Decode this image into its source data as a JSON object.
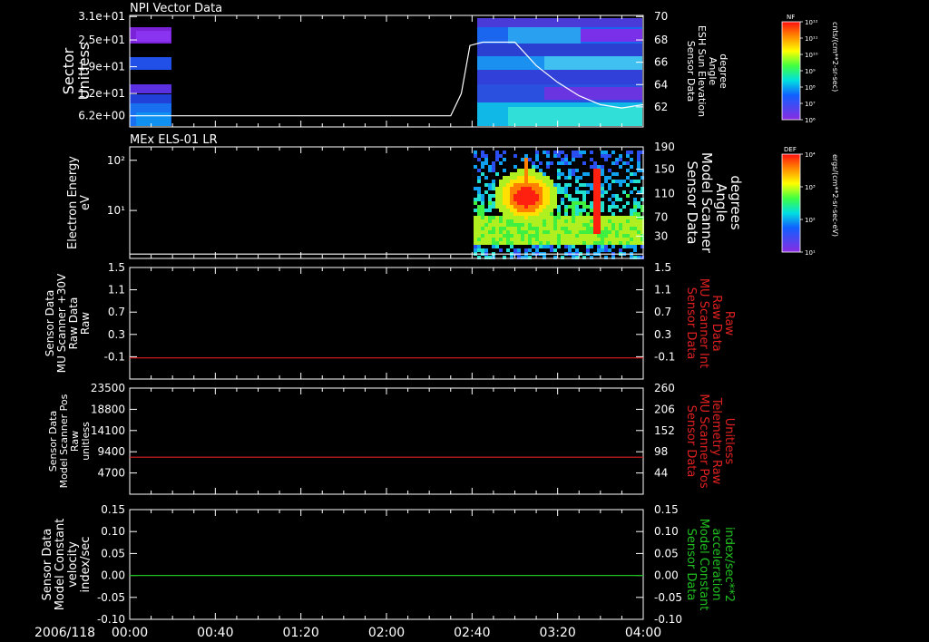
{
  "colors": {
    "background": "#000000",
    "axis": "#ffffff",
    "red_trace": "#e02020",
    "green_trace": "#20c020",
    "white_trace": "#ffffff"
  },
  "time_axis": {
    "date_label": "2006/118",
    "ticks": [
      "00:00",
      "00:40",
      "01:20",
      "02:00",
      "02:40",
      "03:20",
      "04:00"
    ]
  },
  "colorbars": [
    {
      "label": "NF",
      "unit": "cnts/(cm**2-sr-sec)",
      "tick_labels": [
        "10¹²",
        "10¹¹",
        "10¹⁰",
        "10⁹",
        "10⁸",
        "10⁷",
        "10⁶"
      ]
    },
    {
      "label": "DEF",
      "unit": "ergs/(cm**2-sr-sec-eV)",
      "tick_labels": [
        "10⁴",
        "10³",
        "10²",
        "10¹"
      ]
    }
  ],
  "chart_data": [
    {
      "type": "heatmap",
      "title": "NPI Vector Data",
      "ylabel": [
        "Sector",
        "Unitless"
      ],
      "yticks": [
        "3.1e+01",
        "2.5e+01",
        "1.9e+01",
        "1.2e+01",
        "6.2e+00"
      ],
      "y2label": [
        "Sensor Data",
        "ESH Sun Elevation",
        "Angle",
        "degree"
      ],
      "y2ticks": [
        "70",
        "68",
        "66",
        "64",
        "62"
      ],
      "y2lim": [
        60,
        70
      ],
      "overlay": {
        "name": "ESH Sun Elevation Angle",
        "x": [
          "00:00",
          "02:30",
          "02:35",
          "02:39",
          "02:45",
          "03:00",
          "03:10",
          "03:20",
          "03:30",
          "03:40",
          "03:50",
          "04:00"
        ],
        "y": [
          61.0,
          61.0,
          63.0,
          67.3,
          67.6,
          67.6,
          65.5,
          64.0,
          62.8,
          62.0,
          61.7,
          62.0
        ]
      }
    },
    {
      "type": "heatmap",
      "title": "MEx ELS-01 LR",
      "ylabel": [
        "Electron Energy",
        "eV"
      ],
      "yticks": [
        "10²",
        "10¹"
      ],
      "y2label": [
        "Sensor Data",
        "Model Scanner",
        "Angle",
        "degrees"
      ],
      "y2ticks": [
        "190",
        "150",
        "110",
        "70",
        "30"
      ],
      "y2lim": [
        10,
        190
      ],
      "overlay": {
        "name": "Model Scanner Angle",
        "x": [
          "00:00",
          "04:00"
        ],
        "y": [
          17,
          17
        ]
      }
    },
    {
      "type": "line",
      "ylabel": [
        "Sensor Data",
        "MU Scanner +30V",
        "Raw Data",
        "Raw"
      ],
      "yticks": [
        "1.5",
        "1.1",
        "0.7",
        "0.3",
        "-0.1"
      ],
      "ylim": [
        -0.35,
        1.5
      ],
      "y2label": [
        "Sensor Data",
        "MU Scanner Int",
        "Raw Data",
        "Raw"
      ],
      "y2ticks": [
        "1.5",
        "1.1",
        "0.7",
        "0.3",
        "-0.1"
      ],
      "series": [
        {
          "x": [
            "00:00",
            "04:00"
          ],
          "y": [
            0.0,
            0.0
          ],
          "color": "#e02020"
        }
      ]
    },
    {
      "type": "line",
      "ylabel": [
        "Sensor Data",
        "Model Scanner Pos",
        "Raw",
        "unitless"
      ],
      "yticks": [
        "23500",
        "18800",
        "14100",
        "9400",
        "4700"
      ],
      "ylim": [
        0,
        23500
      ],
      "y2label": [
        "Sensor Data",
        "MU Scanner Pos",
        "Telemetry Raw",
        "Unitless"
      ],
      "y2ticks": [
        "260",
        "206",
        "152",
        "98",
        "44"
      ],
      "series": [
        {
          "x": [
            "00:00",
            "04:00"
          ],
          "y": [
            8200,
            8200
          ],
          "color": "#e02020"
        }
      ]
    },
    {
      "type": "line",
      "ylabel": [
        "Sensor Data",
        "Model Constant",
        "velocity",
        "index/sec"
      ],
      "yticks": [
        "0.15",
        "0.10",
        "0.05",
        "0.00",
        "-0.05",
        "-0.10"
      ],
      "ylim": [
        -0.1,
        0.15
      ],
      "y2label": [
        "Sensor Data",
        "Model Constant",
        "acceleration",
        "index/sec**2"
      ],
      "y2ticks": [
        "0.15",
        "0.10",
        "0.05",
        "0.00",
        "-0.05",
        "-0.10"
      ],
      "series": [
        {
          "x": [
            "00:00",
            "04:00"
          ],
          "y": [
            0.0,
            0.0
          ],
          "color": "#20c020"
        }
      ]
    }
  ]
}
